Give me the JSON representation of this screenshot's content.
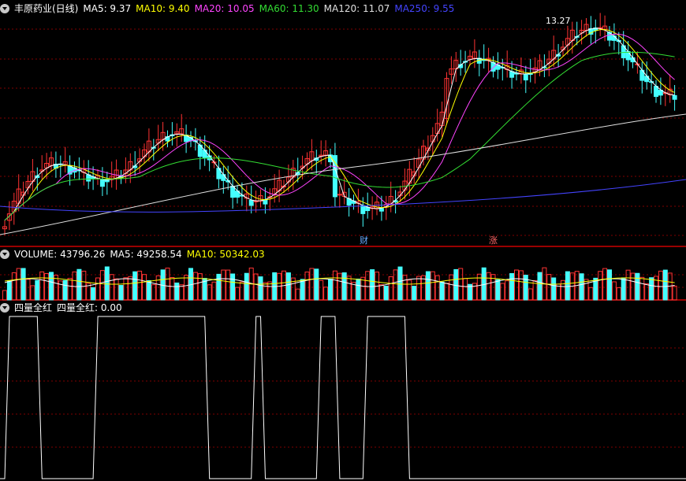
{
  "header": {
    "title": "丰原药业(日线)",
    "ma": [
      {
        "label": "MA5: 9.37",
        "color": "#ffffff"
      },
      {
        "label": "MA10: 9.40",
        "color": "#ffff00"
      },
      {
        "label": "MA20: 10.05",
        "color": "#ff44ff"
      },
      {
        "label": "MA60: 11.30",
        "color": "#33dd33"
      },
      {
        "label": "MA120: 11.07",
        "color": "#e0e0e0"
      },
      {
        "label": "MA250: 9.55",
        "color": "#4444ff"
      }
    ]
  },
  "volume_header": {
    "items": [
      {
        "label": "VOLUME: 43796.26",
        "color": "#ffffff"
      },
      {
        "label": "MA5: 49258.54",
        "color": "#ffffff"
      },
      {
        "label": "MA10: 50342.03",
        "color": "#ffff00"
      }
    ]
  },
  "signal_header": {
    "items": [
      {
        "label": "四量全红",
        "color": "#ffffff"
      },
      {
        "label": "四量全红: 0.00",
        "color": "#ffffff"
      }
    ]
  },
  "markers": {
    "cai": "财",
    "zhang": "涨",
    "peak": "13.27"
  },
  "colors": {
    "up": "#ff3333",
    "down": "#44ffff",
    "grid": "#800000",
    "divider": "#cc0000"
  },
  "chart_data": {
    "type": "candlestick",
    "price_ylim": [
      8.0,
      13.5
    ],
    "volume_ylim": [
      0,
      100000
    ],
    "annotation": {
      "peak_value": 13.27
    },
    "signal_ylim": [
      0,
      1
    ],
    "signal_ranges": [
      [
        0,
        7
      ],
      [
        19,
        43
      ],
      [
        53,
        55
      ],
      [
        67,
        71
      ],
      [
        77,
        86
      ]
    ]
  }
}
